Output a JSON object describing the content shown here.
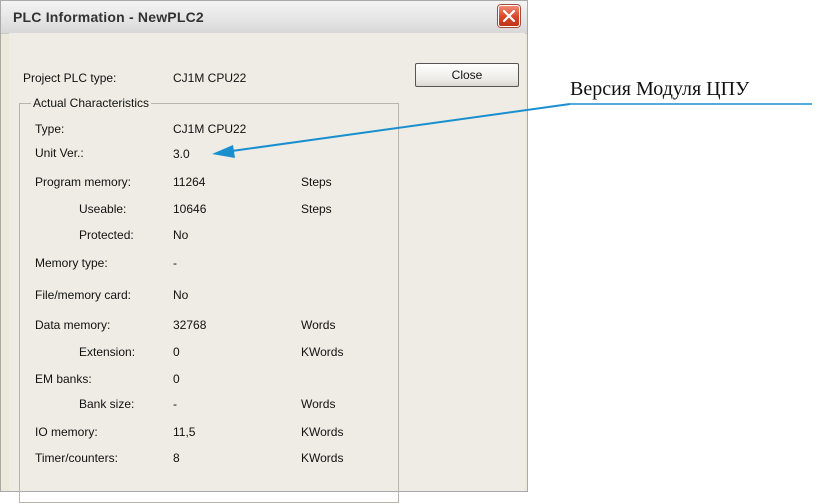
{
  "window": {
    "title": "PLC Information - NewPLC2",
    "close_icon": "close-x-icon",
    "close_color": "#d7452a"
  },
  "project": {
    "label": "Project PLC type:",
    "value": "CJ1M CPU22"
  },
  "close_button": {
    "label": "Close"
  },
  "characteristics": {
    "legend": "Actual Characteristics",
    "rows": [
      {
        "label": "Type:",
        "value": "CJ1M CPU22",
        "unit": ""
      },
      {
        "label": "Unit Ver.:",
        "value": "3.0",
        "unit": ""
      },
      {
        "label": "Program memory:",
        "value": "11264",
        "unit": "Steps"
      },
      {
        "label": "Useable:",
        "value": "10646",
        "unit": "Steps"
      },
      {
        "label": "Protected:",
        "value": "No",
        "unit": ""
      },
      {
        "label": "Memory type:",
        "value": "-",
        "unit": ""
      },
      {
        "label": "File/memory card:",
        "value": "No",
        "unit": ""
      },
      {
        "label": "Data memory:",
        "value": "32768",
        "unit": "Words"
      },
      {
        "label": "Extension:",
        "value": "0",
        "unit": "KWords"
      },
      {
        "label": "EM banks:",
        "value": "0",
        "unit": ""
      },
      {
        "label": "Bank size:",
        "value": "-",
        "unit": "Words"
      },
      {
        "label": "IO memory:",
        "value": "11,5",
        "unit": "KWords"
      },
      {
        "label": "Timer/counters:",
        "value": "8",
        "unit": "KWords"
      }
    ]
  },
  "annotation": {
    "text": "Версия Модуля ЦПУ",
    "arrow_color": "#1a8fd0"
  }
}
